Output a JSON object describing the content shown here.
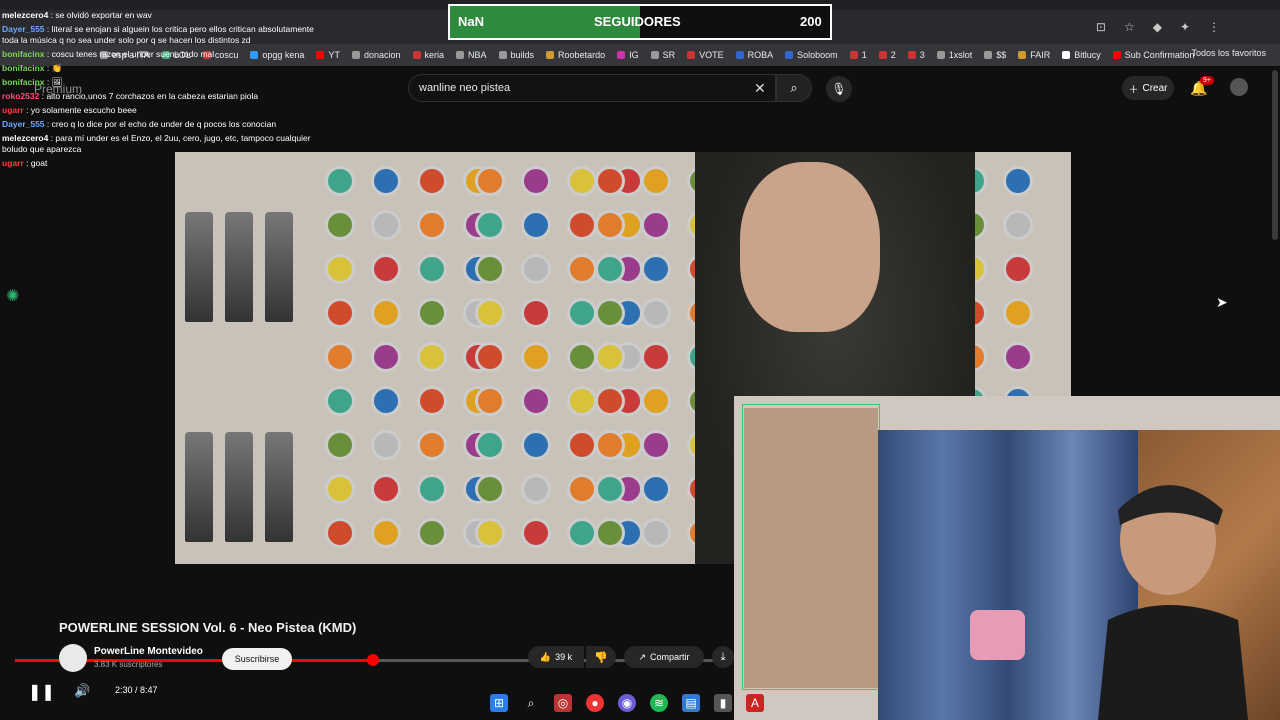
{
  "follower_goal": {
    "current": "NaN",
    "label": "SEGUIDORES",
    "goal": "200",
    "fill_fraction": 0.5,
    "fill_color": "#2e8b3e"
  },
  "bookmarks": [
    {
      "label": "esp a ITA",
      "color": "#999"
    },
    {
      "label": "LOL",
      "color": "#4a7"
    },
    {
      "label": "coscu",
      "color": "#c33"
    },
    {
      "label": "opgg kena",
      "color": "#39f"
    },
    {
      "label": "YT",
      "color": "#f00"
    },
    {
      "label": "donacion",
      "color": "#999"
    },
    {
      "label": "keria",
      "color": "#c33"
    },
    {
      "label": "NBA",
      "color": "#999"
    },
    {
      "label": "builds",
      "color": "#999"
    },
    {
      "label": "Roobetardo",
      "color": "#c93"
    },
    {
      "label": "IG",
      "color": "#c3a"
    },
    {
      "label": "SR",
      "color": "#999"
    },
    {
      "label": "VOTE",
      "color": "#c33"
    },
    {
      "label": "ROBA",
      "color": "#36c"
    },
    {
      "label": "Soloboom",
      "color": "#36c"
    },
    {
      "label": "1",
      "color": "#c33"
    },
    {
      "label": "2",
      "color": "#c33"
    },
    {
      "label": "3",
      "color": "#c33"
    },
    {
      "label": "1xslot",
      "color": "#999"
    },
    {
      "label": "$$",
      "color": "#999"
    },
    {
      "label": "FAIR",
      "color": "#c93"
    },
    {
      "label": "Bitlucy",
      "color": "#fff"
    },
    {
      "label": "Sub Confirmation",
      "color": "#f00"
    }
  ],
  "all_favorites": "Todos los favoritos",
  "header": {
    "premium": "Premium",
    "search_value": "wanline neo pistea",
    "create_label": "Crear",
    "notifications_badge": "9+"
  },
  "chat": [
    {
      "user": "melezcero4",
      "user_color": "#ffffff",
      "text": "se olvidó exportar en wav"
    },
    {
      "user": "Dayer_555",
      "user_color": "#6ea8ff",
      "text": "literal se enojan si alguein los critica pero ellos critican absolutamente toda la música q no sea under solo por q se hacen los distintos zd"
    },
    {
      "user": "bonifacinx",
      "user_color": "#7cd65a",
      "text": "coscu tenes razon el under suena todo mal"
    },
    {
      "user": "bonifacinx",
      "user_color": "#7cd65a",
      "text": "👏"
    },
    {
      "user": "bonifacinx",
      "user_color": "#7cd65a",
      "text": "🖼"
    },
    {
      "user": "roko2532",
      "user_color": "#ff4d7a",
      "text": "alto rancio,unos 7 corchazos en la cabeza estarian piola"
    },
    {
      "user": "ugarr",
      "user_color": "#ff3b3b",
      "text": "yo solamente escucho beee"
    },
    {
      "user": "Dayer_555",
      "user_color": "#6ea8ff",
      "text": "creo q lo dice por el echo de under de q pocos los conocian"
    },
    {
      "user": "melezcero4",
      "user_color": "#ffffff",
      "text": "para mí under es el Enzo, el 2uu, cero, jugo, etc, tampoco cualquier boludo que aparezca"
    },
    {
      "user": "ugarr",
      "user_color": "#ff3b3b",
      "text": "goat"
    }
  ],
  "video": {
    "title": "POWERLINE SESSION Vol. 6 - Neo Pistea (KMD)",
    "channel": "PowerLine Montevideo",
    "subscribers": "3.83 K suscriptores",
    "subscribe_label": "Suscribirse",
    "likes": "39 k",
    "share_label": "Compartir",
    "time": "2:30 / 8:47",
    "progress_fraction": 0.285
  }
}
